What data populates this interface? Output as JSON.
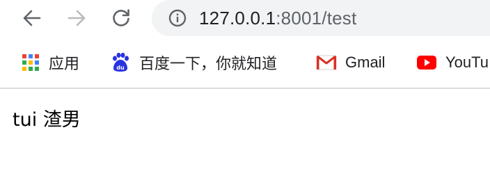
{
  "toolbar": {
    "back_icon": "arrow-left-icon",
    "forward_icon": "arrow-right-icon",
    "reload_icon": "reload-icon",
    "info_icon": "info-circle-icon"
  },
  "address_bar": {
    "host": "127.0.0.1",
    "rest": ":8001/test"
  },
  "bookmarks": [
    {
      "label": "应用",
      "icon": "apps-grid-icon"
    },
    {
      "label": "百度一下，你就知道",
      "icon": "baidu-paw-icon"
    },
    {
      "label": "Gmail",
      "icon": "gmail-icon"
    },
    {
      "label": "YouTu",
      "icon": "youtube-icon"
    }
  ],
  "page": {
    "text": "tui 渣男"
  },
  "colors": {
    "omnibox_bg": "#f1f3f4",
    "youtube_red": "#ff0000",
    "gmail_red": "#d93025",
    "baidu_blue": "#2932e1",
    "text": "#202124",
    "muted": "#5f6368"
  }
}
